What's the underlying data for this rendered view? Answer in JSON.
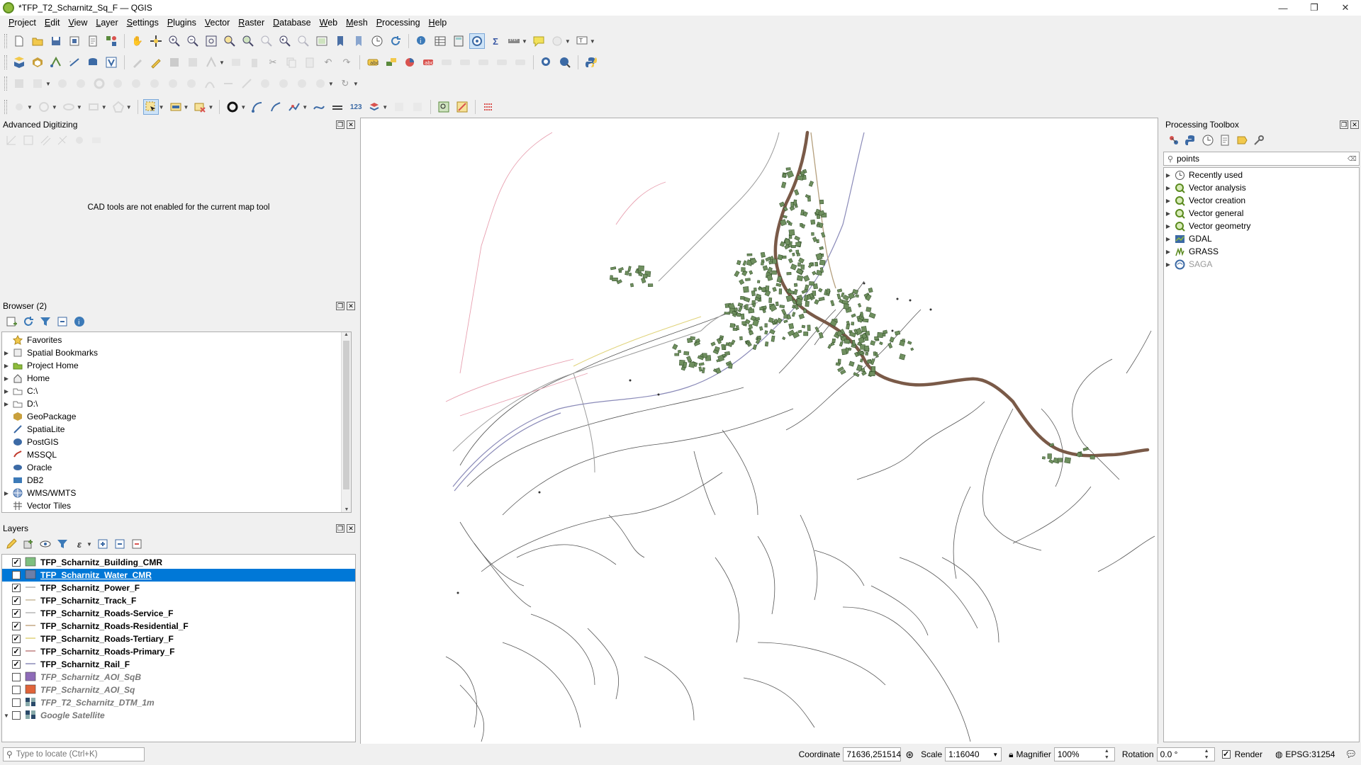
{
  "window": {
    "title": "*TFP_T2_Scharnitz_Sq_F — QGIS",
    "minimize": "—",
    "maximize": "❐",
    "close": "✕"
  },
  "menubar": {
    "items": [
      "Project",
      "Edit",
      "View",
      "Layer",
      "Settings",
      "Plugins",
      "Vector",
      "Raster",
      "Database",
      "Web",
      "Mesh",
      "Processing",
      "Help"
    ]
  },
  "advanced_digitizing": {
    "title": "Advanced Digitizing",
    "message": "CAD tools are not enabled for the current map tool"
  },
  "browser": {
    "title": "Browser (2)",
    "items": [
      {
        "label": "Favorites",
        "icon": "star-icon",
        "expandable": false
      },
      {
        "label": "Spatial Bookmarks",
        "icon": "bookmark-icon",
        "expandable": true
      },
      {
        "label": "Project Home",
        "icon": "project-home-icon",
        "expandable": true
      },
      {
        "label": "Home",
        "icon": "home-icon",
        "expandable": true
      },
      {
        "label": "C:\\",
        "icon": "folder-icon",
        "expandable": true
      },
      {
        "label": "D:\\",
        "icon": "folder-icon",
        "expandable": true
      },
      {
        "label": "GeoPackage",
        "icon": "geopackage-icon",
        "expandable": false
      },
      {
        "label": "SpatiaLite",
        "icon": "spatialite-icon",
        "expandable": false
      },
      {
        "label": "PostGIS",
        "icon": "postgis-icon",
        "expandable": false
      },
      {
        "label": "MSSQL",
        "icon": "mssql-icon",
        "expandable": false
      },
      {
        "label": "Oracle",
        "icon": "oracle-icon",
        "expandable": false
      },
      {
        "label": "DB2",
        "icon": "db2-icon",
        "expandable": false
      },
      {
        "label": "WMS/WMTS",
        "icon": "wms-icon",
        "expandable": true
      },
      {
        "label": "Vector Tiles",
        "icon": "vector-tiles-icon",
        "expandable": false
      }
    ]
  },
  "layers": {
    "title": "Layers",
    "items": [
      {
        "name": "TFP_Scharnitz_Building_CMR",
        "checked": true,
        "symbol": "fill",
        "color": "#7fbf7f",
        "selected": false
      },
      {
        "name": "TFP_Scharnitz_Water_CMR",
        "checked": true,
        "symbol": "fill",
        "color": "#6c7fa8",
        "selected": true
      },
      {
        "name": "TFP_Scharnitz_Power_F",
        "checked": true,
        "symbol": "line",
        "color": "#b0b0b0",
        "selected": false
      },
      {
        "name": "TFP_Scharnitz_Track_F",
        "checked": true,
        "symbol": "line",
        "color": "#c9b99a",
        "selected": false
      },
      {
        "name": "TFP_Scharnitz_Roads-Service_F",
        "checked": true,
        "symbol": "line",
        "color": "#b7b7b7",
        "selected": false
      },
      {
        "name": "TFP_Scharnitz_Roads-Residential_F",
        "checked": true,
        "symbol": "line",
        "color": "#c4a884",
        "selected": false
      },
      {
        "name": "TFP_Scharnitz_Roads-Tertiary_F",
        "checked": true,
        "symbol": "line",
        "color": "#e0d37a",
        "selected": false
      },
      {
        "name": "TFP_Scharnitz_Roads-Primary_F",
        "checked": true,
        "symbol": "line",
        "color": "#c08080",
        "selected": false
      },
      {
        "name": "TFP_Scharnitz_Rail_F",
        "checked": true,
        "symbol": "line",
        "color": "#8a8ab8",
        "selected": false
      },
      {
        "name": "TFP_Scharnitz_AOI_SqB",
        "checked": false,
        "symbol": "fill",
        "color": "#8e6bb8",
        "selected": false
      },
      {
        "name": "TFP_Scharnitz_AOI_Sq",
        "checked": false,
        "symbol": "fill",
        "color": "#e0643a",
        "selected": false
      },
      {
        "name": "TFP_T2_Scharnitz_DTM_1m",
        "checked": false,
        "symbol": "raster",
        "color": "#2a4a6a",
        "selected": false
      },
      {
        "name": "Google Satellite",
        "checked": false,
        "symbol": "raster",
        "color": "#2a4a6a",
        "selected": false,
        "expanded": true
      }
    ]
  },
  "processing": {
    "title": "Processing Toolbox",
    "search_value": "points",
    "items": [
      {
        "label": "Recently used",
        "icon": "clock-icon",
        "disabled": false
      },
      {
        "label": "Vector analysis",
        "icon": "qgis-icon",
        "disabled": false
      },
      {
        "label": "Vector creation",
        "icon": "qgis-icon",
        "disabled": false
      },
      {
        "label": "Vector general",
        "icon": "qgis-icon",
        "disabled": false
      },
      {
        "label": "Vector geometry",
        "icon": "qgis-icon",
        "disabled": false
      },
      {
        "label": "GDAL",
        "icon": "gdal-icon",
        "disabled": false
      },
      {
        "label": "GRASS",
        "icon": "grass-icon",
        "disabled": false
      },
      {
        "label": "SAGA",
        "icon": "saga-icon",
        "disabled": true
      }
    ]
  },
  "statusbar": {
    "locator_placeholder": "Type to locate (Ctrl+K)",
    "coordinate_label": "Coordinate",
    "coordinate_value": "71636,251514",
    "scale_label": "Scale",
    "scale_value": "1:16040",
    "magnifier_label": "Magnifier",
    "magnifier_value": "100%",
    "rotation_label": "Rotation",
    "rotation_value": "0.0 °",
    "render_label": "Render",
    "render_checked": true,
    "crs": "EPSG:31254"
  },
  "colors": {
    "selection": "#0078d7",
    "river": "#7a5a48",
    "buildings": "#6f8f5f"
  }
}
